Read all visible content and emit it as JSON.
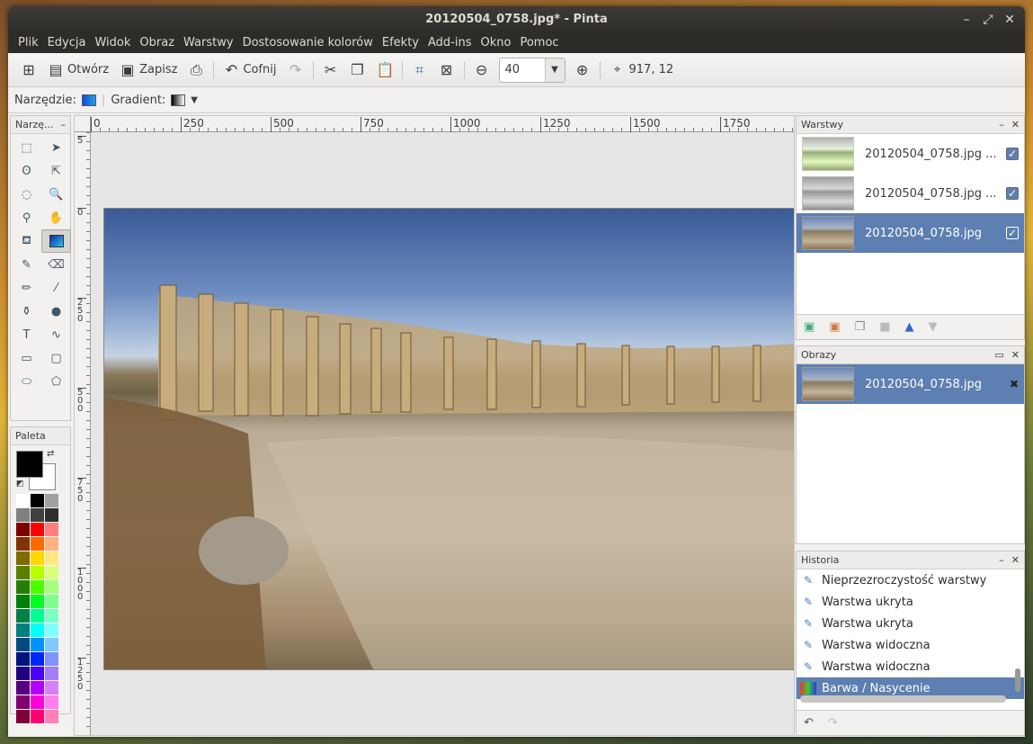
{
  "window": {
    "title": "20120504_0758.jpg* - Pinta",
    "controls": [
      "–",
      "⤢",
      "✕"
    ]
  },
  "menu": [
    "Plik",
    "Edycja",
    "Widok",
    "Obraz",
    "Warstwy",
    "Dostosowanie kolorów",
    "Efekty",
    "Add-ins",
    "Okno",
    "Pomoc"
  ],
  "toolbar": {
    "open_label": "Otwórz",
    "save_label": "Zapisz",
    "undo_label": "Cofnij",
    "zoom_value": "40",
    "cursor_position": "917, 12"
  },
  "tool_options": {
    "tool_label": "Narzędzie:",
    "gradient_label": "Gradient:"
  },
  "toolbox": {
    "title": "Narzę...",
    "close": "–"
  },
  "palette_panel": {
    "title": "Paleta",
    "primary_color": "#000000",
    "secondary_color": "#ffffff",
    "swatches": [
      "#ffffff",
      "#000000",
      "#a0a0a0",
      "#808080",
      "#404040",
      "#303030",
      "#7f0000",
      "#ff0000",
      "#ff7f7f",
      "#7f3300",
      "#ff6a00",
      "#ffb27f",
      "#7f6a00",
      "#ffd800",
      "#ffe97f",
      "#5b7f00",
      "#b6ff00",
      "#daff7f",
      "#267f00",
      "#4cff00",
      "#a5ff7f",
      "#007f0e",
      "#00ff21",
      "#7fff8e",
      "#007f46",
      "#00ff90",
      "#7fffc5",
      "#007f7f",
      "#00ffff",
      "#7fffff",
      "#004a7f",
      "#0094ff",
      "#7fc9ff",
      "#00137f",
      "#0026ff",
      "#7f92ff",
      "#21007f",
      "#4800ff",
      "#a17fff",
      "#57007f",
      "#b200ff",
      "#d67fff",
      "#7f006e",
      "#ff00dc",
      "#ff7fed",
      "#7f0037",
      "#ff006e",
      "#ff7fb6"
    ]
  },
  "rulers": {
    "h_labels": [
      "0",
      "250",
      "500",
      "750",
      "1000",
      "1250",
      "1500",
      "1750"
    ],
    "v_labels": [
      "5",
      "0",
      "250",
      "500",
      "750",
      "1000",
      "1250"
    ]
  },
  "layers_panel": {
    "title": "Warstwy",
    "layers": [
      {
        "name": "20120504_0758.jpg ...",
        "visible": true,
        "selected": false
      },
      {
        "name": "20120504_0758.jpg ...",
        "visible": true,
        "selected": false
      },
      {
        "name": "20120504_0758.jpg",
        "visible": true,
        "selected": true
      }
    ]
  },
  "images_panel": {
    "title": "Obrazy",
    "images": [
      {
        "name": "20120504_0758.jpg"
      }
    ]
  },
  "history_panel": {
    "title": "Historia",
    "items": [
      "Nieprzezroczystość warstwy",
      "Warstwa ukryta",
      "Warstwa ukryta",
      "Warstwa widoczna",
      "Warstwa widoczna",
      "Barwa / Nasycenie"
    ],
    "selected_index": 5
  }
}
